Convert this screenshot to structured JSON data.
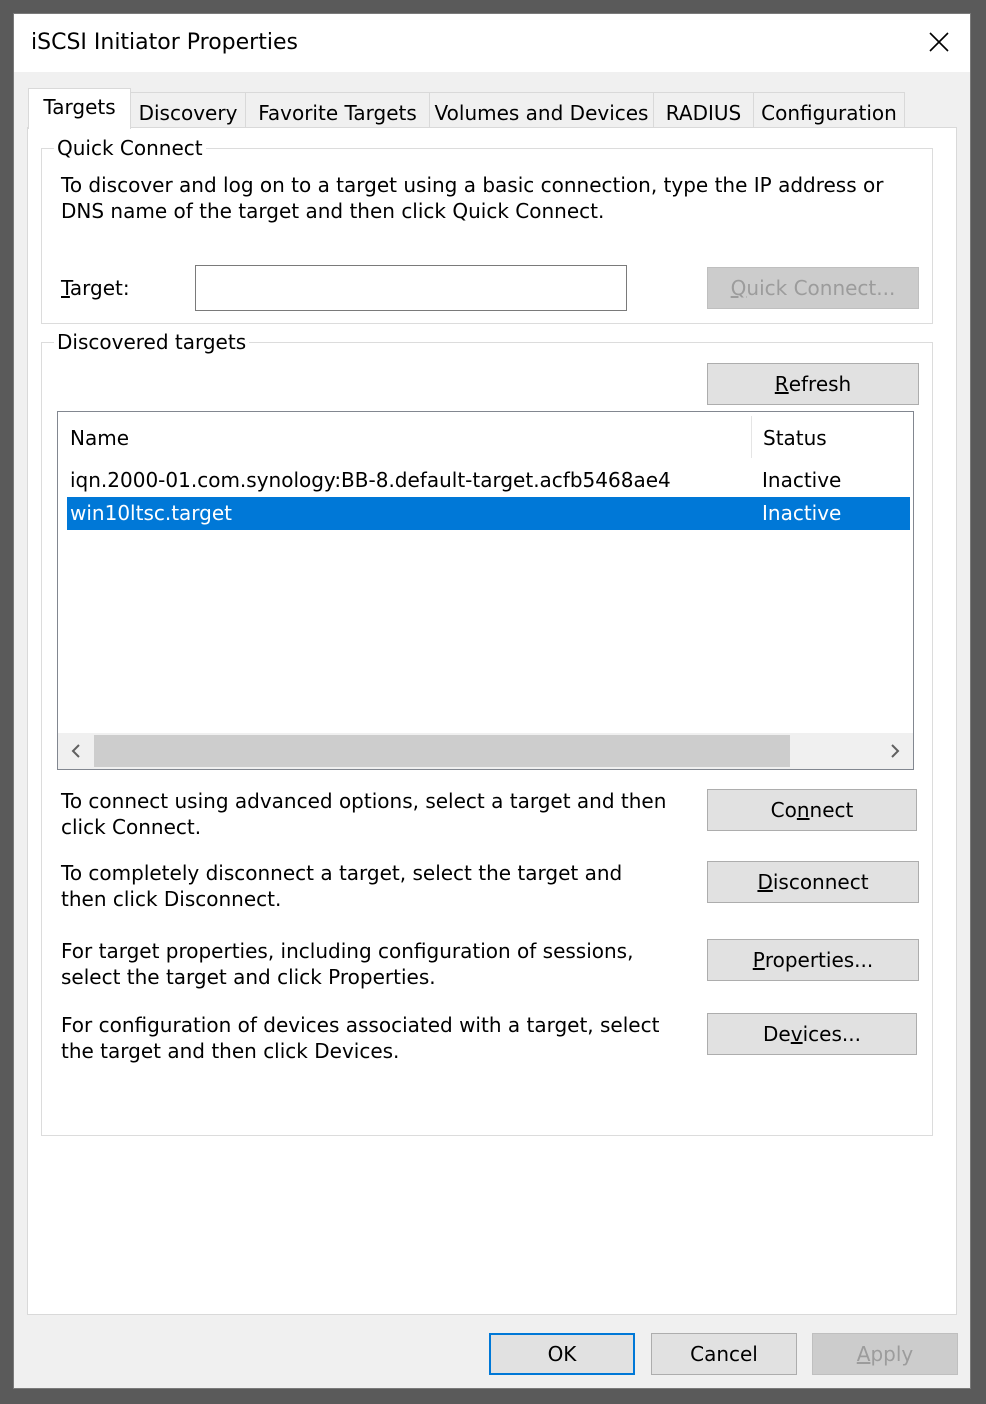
{
  "window": {
    "title": "iSCSI Initiator Properties"
  },
  "tabs": [
    {
      "label": "Targets",
      "active": true
    },
    {
      "label": "Discovery"
    },
    {
      "label": "Favorite Targets"
    },
    {
      "label": "Volumes and Devices"
    },
    {
      "label": "RADIUS"
    },
    {
      "label": "Configuration"
    }
  ],
  "quick_connect": {
    "legend": "Quick Connect",
    "description_line1": "To discover and log on to a target using a basic connection, type the IP address or",
    "description_line2": "DNS name of the target and then click Quick Connect.",
    "target_label_accel": "T",
    "target_label_rest": "arget:",
    "target_value": "",
    "button_accel": "Q",
    "button_rest": "uick Connect..."
  },
  "discovered": {
    "legend": "Discovered targets",
    "refresh_accel": "R",
    "refresh_rest": "efresh",
    "columns": [
      "Name",
      "Status"
    ],
    "rows": [
      {
        "name": "iqn.2000-01.com.synology:BB-8.default-target.acfb5468ae4",
        "status": "Inactive",
        "selected": false
      },
      {
        "name": "win10ltsc.target",
        "status": "Inactive",
        "selected": true
      }
    ]
  },
  "actions": {
    "connect_text1": "To connect using advanced options, select a target and then",
    "connect_text2": "click Connect.",
    "connect_pre": "Co",
    "connect_accel": "n",
    "connect_post": "nect",
    "disconnect_text1": "To completely disconnect a target, select the target and",
    "disconnect_text2": "then click Disconnect.",
    "disconnect_accel": "D",
    "disconnect_rest": "isconnect",
    "properties_text1": "For target properties, including configuration of sessions,",
    "properties_text2": "select the target and click Properties.",
    "properties_accel": "P",
    "properties_rest": "roperties...",
    "devices_text1": "For configuration of devices associated with a target, select",
    "devices_text2": "the target and then click Devices.",
    "devices_pre": "De",
    "devices_accel": "v",
    "devices_post": "ices..."
  },
  "footer": {
    "ok_label": "OK",
    "cancel_label": "Cancel",
    "apply_accel": "A",
    "apply_rest": "pply"
  },
  "colors": {
    "selection": "#0078d7",
    "window_bg": "#f0f0f0",
    "panel_bg": "#ffffff"
  }
}
